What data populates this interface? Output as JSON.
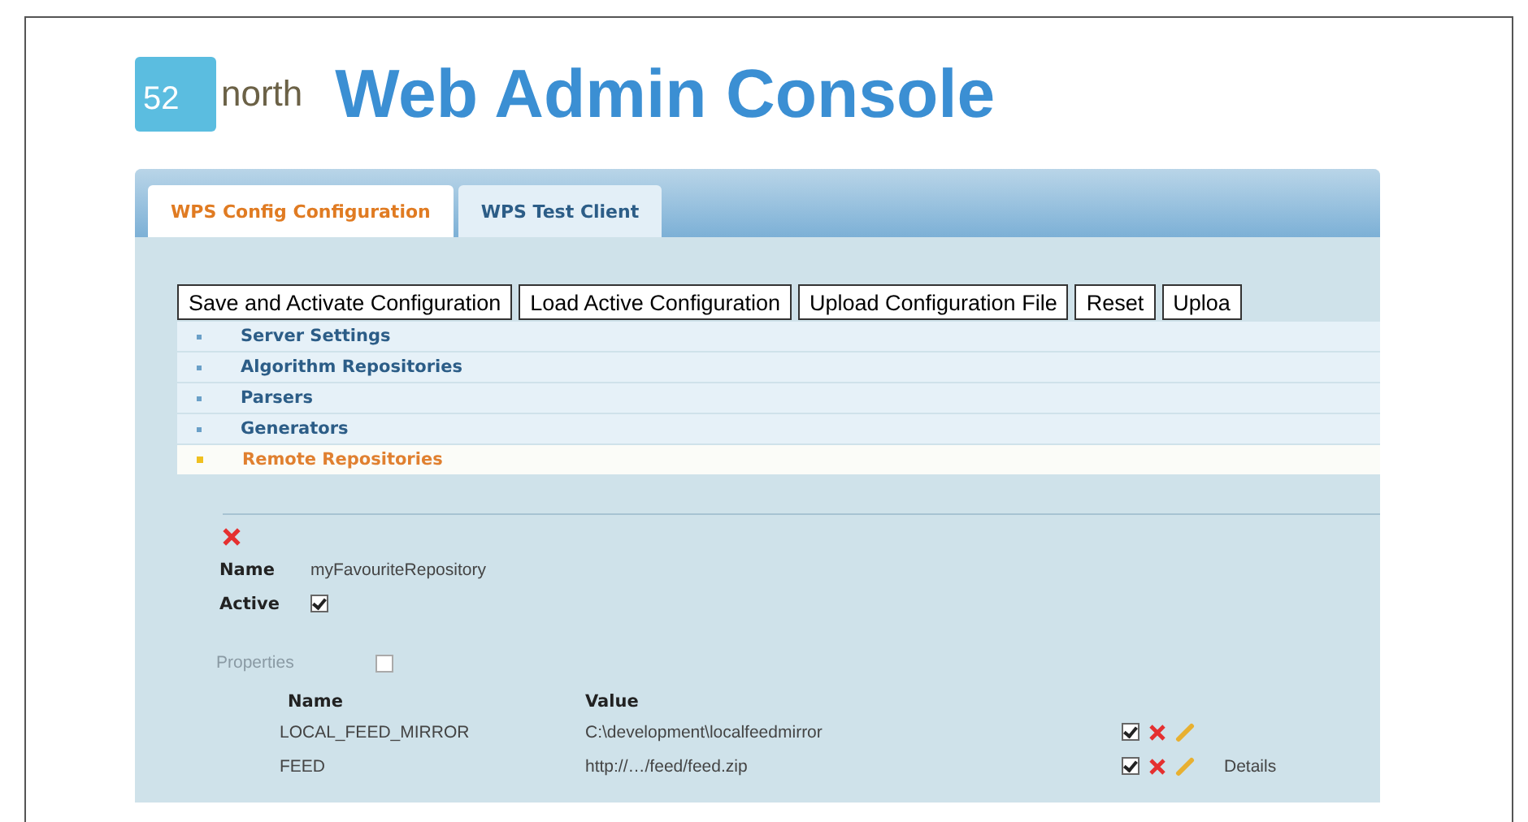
{
  "logo": {
    "badge": "52",
    "text": "north"
  },
  "title": "Web Admin Console",
  "tabs": [
    {
      "label": "WPS Config Configuration",
      "selected": true
    },
    {
      "label": "WPS Test Client",
      "selected": false
    }
  ],
  "buttons": [
    "Save and Activate Configuration",
    "Load Active Configuration",
    "Upload Configuration File",
    "Reset",
    "Uploa"
  ],
  "sections": [
    {
      "label": "Server Settings",
      "expanded": false
    },
    {
      "label": "Algorithm Repositories",
      "expanded": false
    },
    {
      "label": "Parsers",
      "expanded": false
    },
    {
      "label": "Generators",
      "expanded": false
    },
    {
      "label": "Remote Repositories",
      "expanded": true
    }
  ],
  "repository": {
    "name_label": "Name",
    "name": "myFavouriteRepository",
    "active_label": "Active",
    "active": true,
    "properties_label": "Properties",
    "properties_checked": false
  },
  "properties": {
    "columns": [
      "Name",
      "Value"
    ],
    "rows": [
      {
        "name": "LOCAL_FEED_MIRROR",
        "value": "C:\\development\\localfeedmirror",
        "active": true
      },
      {
        "name": "FEED",
        "value": "http://…/feed/feed.zip",
        "active": true,
        "details": "Details"
      }
    ]
  }
}
